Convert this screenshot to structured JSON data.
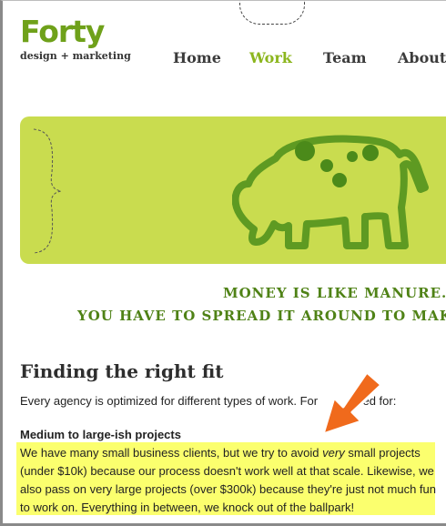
{
  "header": {
    "logo_name": "Forty",
    "logo_tagline": "design + marketing"
  },
  "nav": {
    "items": [
      "Home",
      "Work",
      "Team",
      "About"
    ],
    "active": "Work"
  },
  "banner": {
    "illustration": "cow-illustration",
    "quote_line1": "MONEY IS LIKE MANURE.",
    "quote_line2": "YOU HAVE TO SPREAD IT AROUND TO MAKE"
  },
  "section": {
    "heading": "Finding the right fit",
    "intro": "Every agency is optimized for different types of work. For",
    "intro_tail": "ized for:",
    "subheading": "Medium to large-ish projects",
    "para_before_em": "We have many small business clients, but we try to avoid ",
    "para_em": "very",
    "para_after_em": " small projects (under $10k) because our process doesn't work well at that scale. Likewise, we also pass on very large projects (over $300k) because they're just not much fun to work on. Everything in between, we knock out of the ballpark!"
  },
  "colors": {
    "brand_green": "#6fa11a",
    "nav_active": "#8cb61e",
    "banner_bg": "#c9dc4f",
    "quote_green": "#4f8216",
    "highlight": "#fbff6e",
    "arrow": "#f06a1c"
  }
}
